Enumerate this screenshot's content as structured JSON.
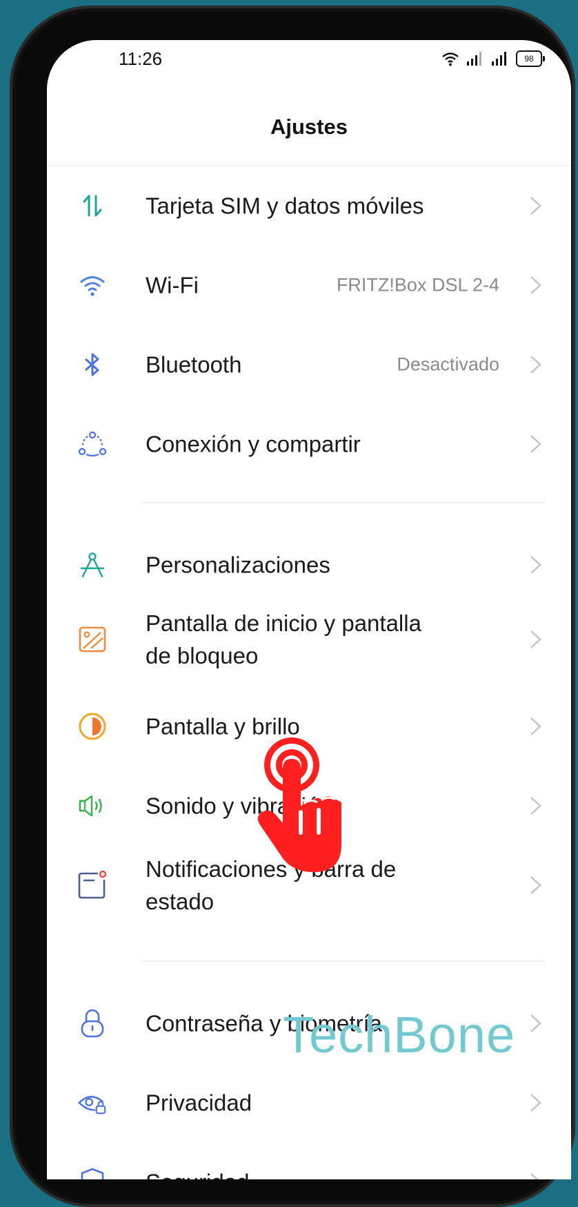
{
  "status_bar": {
    "time": "11:26",
    "battery": "98"
  },
  "page": {
    "title": "Ajustes"
  },
  "settings": [
    {
      "label": "Tarjeta SIM y datos móviles",
      "value": "",
      "icon": "sim-data-icon"
    },
    {
      "label": "Wi-Fi",
      "value": "FRITZ!Box DSL 2-4",
      "icon": "wifi-icon"
    },
    {
      "label": "Bluetooth",
      "value": "Desactivado",
      "icon": "bluetooth-icon"
    },
    {
      "label": "Conexión y compartir",
      "value": "",
      "icon": "connection-share-icon"
    },
    {
      "label": "Personalizaciones",
      "value": "",
      "icon": "compass-icon"
    },
    {
      "label": "Pantalla de inicio y pantalla de bloqueo",
      "value": "",
      "icon": "wallpaper-icon"
    },
    {
      "label": "Pantalla y brillo",
      "value": "",
      "icon": "brightness-icon"
    },
    {
      "label": "Sonido y vibración",
      "value": "",
      "icon": "speaker-icon"
    },
    {
      "label": "Notificaciones y barra de estado",
      "value": "",
      "icon": "notification-icon"
    },
    {
      "label": "Contraseña y biometría",
      "value": "",
      "icon": "lock-icon"
    },
    {
      "label": "Privacidad",
      "value": "",
      "icon": "privacy-eye-icon"
    },
    {
      "label": "Seguridad",
      "value": "",
      "icon": "shield-icon"
    }
  ],
  "watermark": "TechBone",
  "colors": {
    "background": "#1a7082",
    "pointer_hand": "#ff1f1f",
    "watermark": "#72c9d0"
  }
}
